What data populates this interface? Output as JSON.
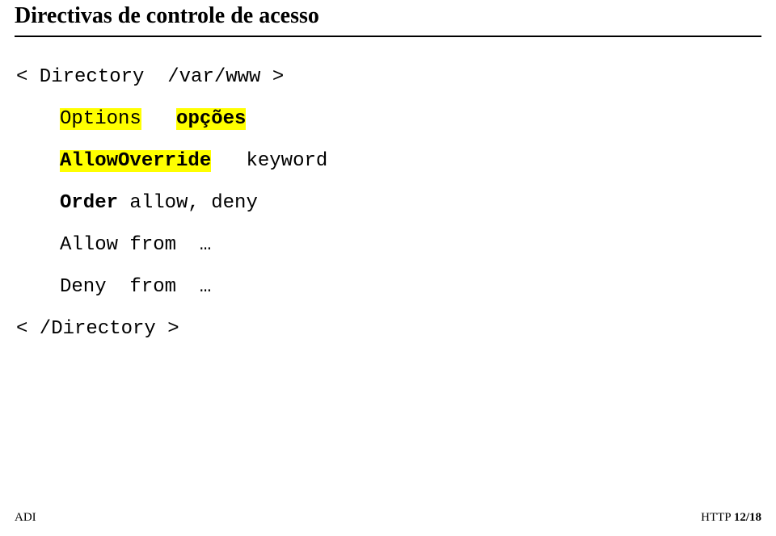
{
  "title": "Directivas de controle de acesso",
  "code": {
    "open_tag": "< Directory  /var/www >",
    "options_key": "Options",
    "options_val": "opções",
    "allowoverride_key": "AllowOverride",
    "allowoverride_val": "keyword",
    "order_key": "Order",
    "order_val": " allow, deny",
    "allow_line": "Allow from  …",
    "deny_line": "Deny  from  …",
    "close_tag": "< /Directory >"
  },
  "footer": {
    "left": "ADI",
    "right_label": "HTTP ",
    "right_page": "12/18"
  }
}
